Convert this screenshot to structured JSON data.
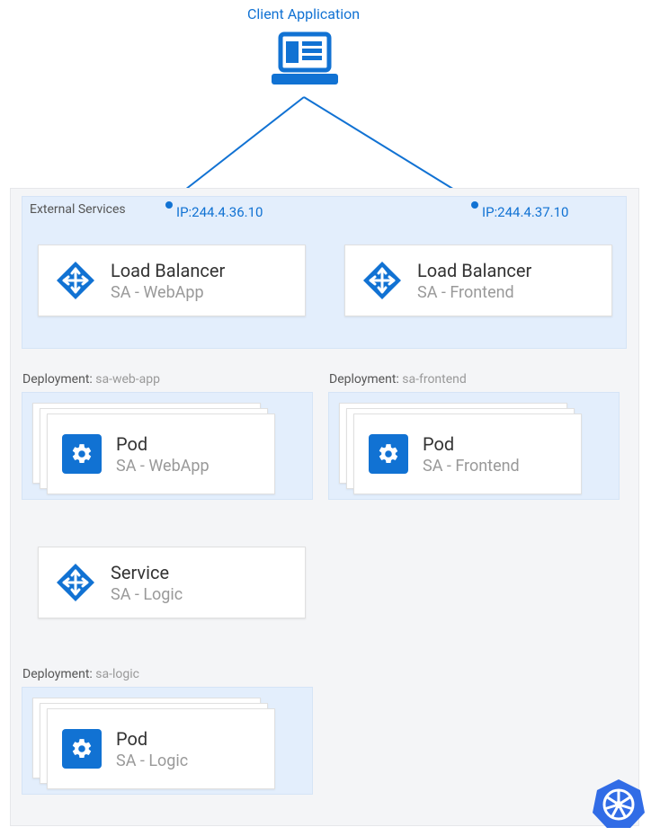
{
  "client_label": "Client Application",
  "external_services_label": "External Services",
  "lb_left": {
    "ip": "IP:244.4.36.10",
    "title": "Load Balancer",
    "sub": "SA - WebApp"
  },
  "lb_right": {
    "ip": "IP:244.4.37.10",
    "title": "Load Balancer",
    "sub": "SA - Frontend"
  },
  "dep_webapp": {
    "label_prefix": "Deployment: ",
    "label_value": "sa-web-app",
    "title": "Pod",
    "sub": "SA - WebApp"
  },
  "dep_frontend": {
    "label_prefix": "Deployment: ",
    "label_value": "sa-frontend",
    "title": "Pod",
    "sub": "SA - Frontend"
  },
  "service_logic": {
    "title": "Service",
    "sub": "SA - Logic"
  },
  "dep_logic": {
    "label_prefix": "Deployment: ",
    "label_value": "sa-logic",
    "title": "Pod",
    "sub": "SA - Logic"
  },
  "colors": {
    "accent": "#1172d3",
    "group_bg": "#e3eefc",
    "muted": "#999"
  }
}
